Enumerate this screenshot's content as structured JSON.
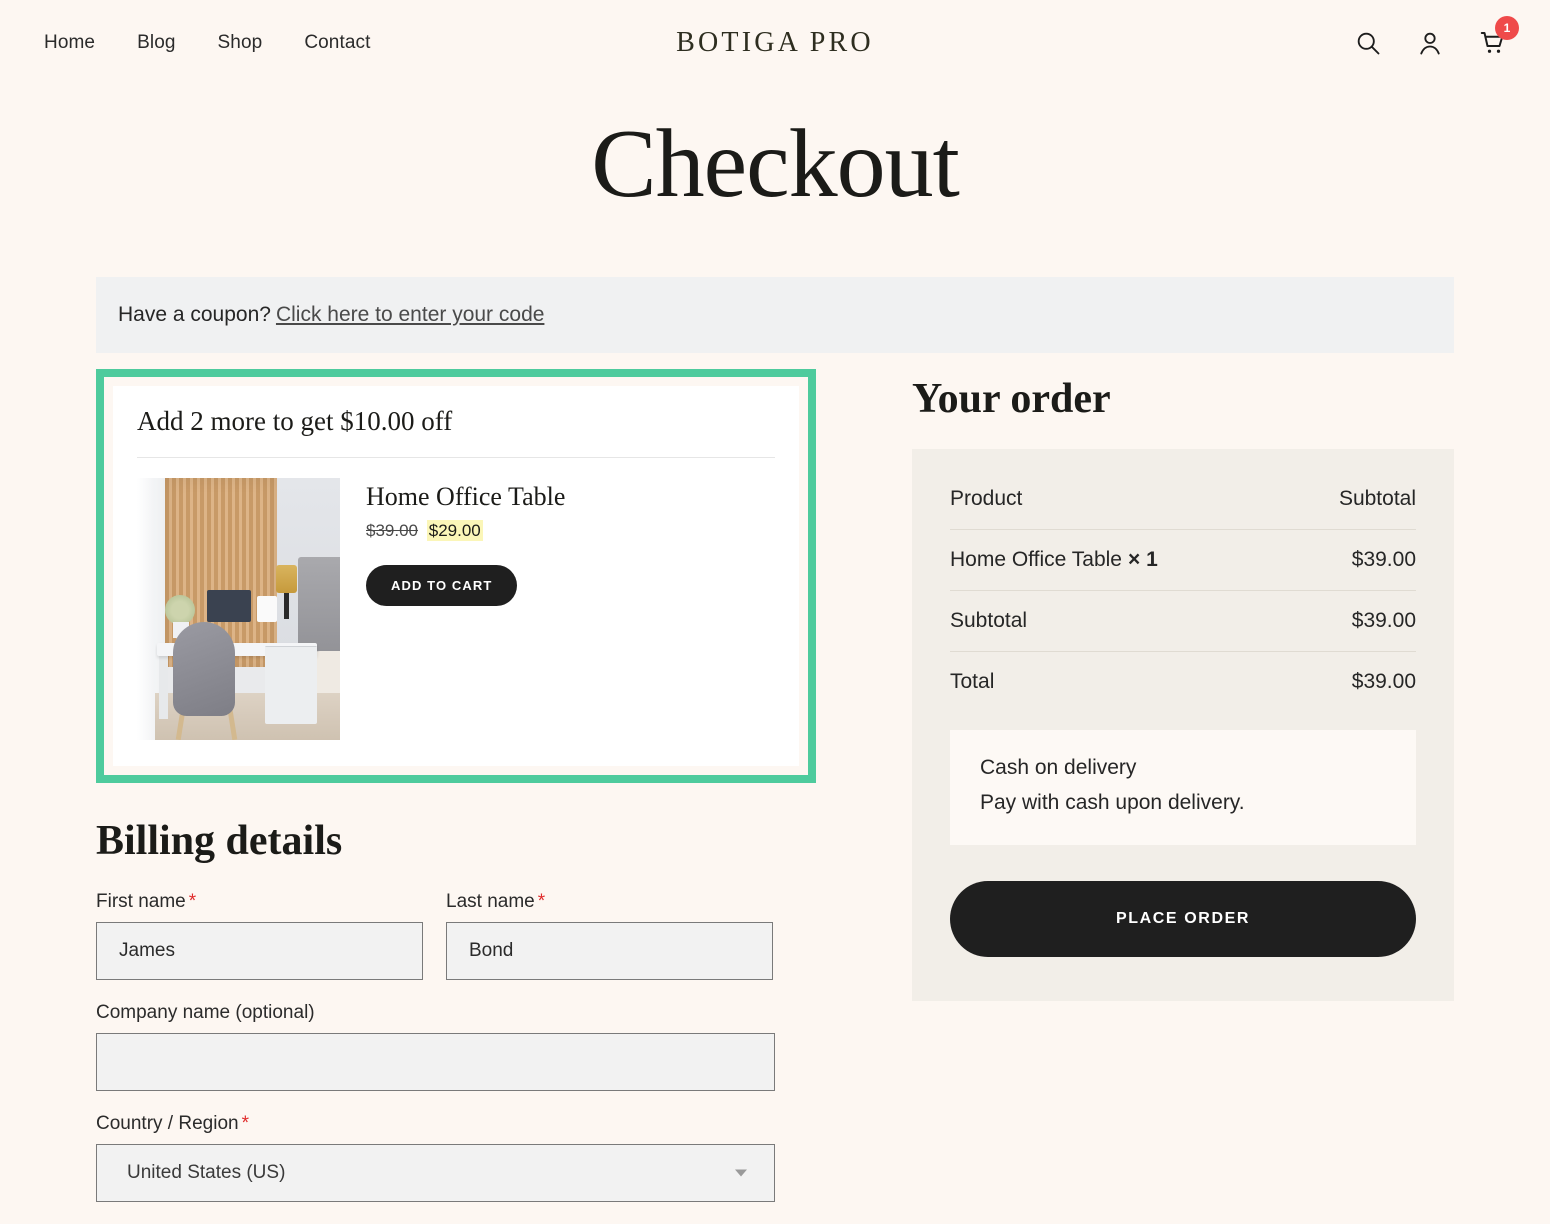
{
  "header": {
    "nav": [
      {
        "label": "Home"
      },
      {
        "label": "Blog"
      },
      {
        "label": "Shop"
      },
      {
        "label": "Contact"
      }
    ],
    "logo": "BOTIGA PRO",
    "icons": {
      "search": "search-icon",
      "account": "user-icon",
      "cart": "cart-icon"
    },
    "cart_count": "1"
  },
  "page": {
    "title": "Checkout"
  },
  "coupon": {
    "text": "Have a coupon?",
    "link": "Click here to enter your code"
  },
  "upsell": {
    "highlight_color": "#4ecb9d",
    "title": "Add 2 more to get $10.00 off",
    "product": {
      "name": "Home Office Table",
      "price_old": "$39.00",
      "price_new": "$29.00",
      "add_to_cart_label": "ADD TO CART",
      "image_alt": "home-office-desk-photo"
    }
  },
  "billing": {
    "title": "Billing details",
    "fields": {
      "first_name": {
        "label": "First name",
        "required": "*",
        "value": "James"
      },
      "last_name": {
        "label": "Last name",
        "required": "*",
        "value": "Bond"
      },
      "company": {
        "label": "Company name (optional)",
        "value": ""
      },
      "country": {
        "label": "Country / Region",
        "required": "*",
        "value": "United States (US)"
      }
    }
  },
  "order": {
    "title": "Your order",
    "columns": {
      "product": "Product",
      "subtotal": "Subtotal"
    },
    "items": [
      {
        "name": "Home Office Table",
        "qty": "× 1",
        "amount": "$39.00"
      }
    ],
    "subtotal": {
      "label": "Subtotal",
      "amount": "$39.00"
    },
    "total": {
      "label": "Total",
      "amount": "$39.00"
    },
    "payment": {
      "method": "Cash on delivery",
      "description": "Pay with cash upon delivery."
    },
    "place_order_label": "PLACE ORDER"
  }
}
